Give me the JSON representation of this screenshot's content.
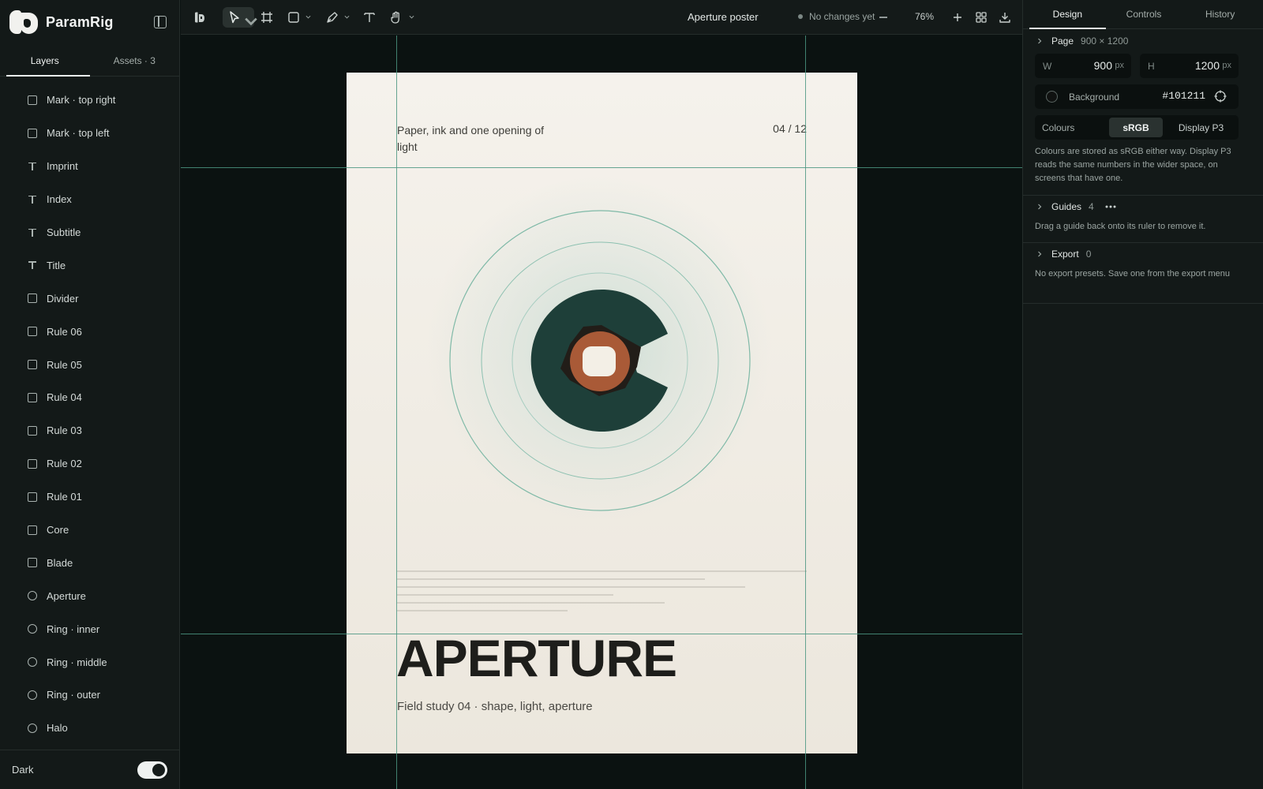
{
  "app": {
    "name": "ParamRig"
  },
  "sidebar": {
    "tabs": [
      {
        "label": "Layers"
      },
      {
        "label": "Assets · 3"
      }
    ],
    "layers": [
      {
        "name": "Mark · top right",
        "icon": "rectangle-icon"
      },
      {
        "name": "Mark · top left",
        "icon": "rectangle-icon"
      },
      {
        "name": "Imprint",
        "icon": "text-icon"
      },
      {
        "name": "Index",
        "icon": "text-icon"
      },
      {
        "name": "Subtitle",
        "icon": "text-icon"
      },
      {
        "name": "Title",
        "icon": "text-icon"
      },
      {
        "name": "Divider",
        "icon": "rectangle-icon"
      },
      {
        "name": "Rule 06",
        "icon": "rectangle-icon"
      },
      {
        "name": "Rule 05",
        "icon": "rectangle-icon"
      },
      {
        "name": "Rule 04",
        "icon": "rectangle-icon"
      },
      {
        "name": "Rule 03",
        "icon": "rectangle-icon"
      },
      {
        "name": "Rule 02",
        "icon": "rectangle-icon"
      },
      {
        "name": "Rule 01",
        "icon": "rectangle-icon"
      },
      {
        "name": "Core",
        "icon": "rectangle-icon"
      },
      {
        "name": "Blade",
        "icon": "rectangle-icon"
      },
      {
        "name": "Aperture",
        "icon": "ellipse-icon"
      },
      {
        "name": "Ring · inner",
        "icon": "ellipse-icon"
      },
      {
        "name": "Ring · middle",
        "icon": "ellipse-icon"
      },
      {
        "name": "Ring · outer",
        "icon": "ellipse-icon"
      },
      {
        "name": "Halo",
        "icon": "ellipse-icon"
      }
    ],
    "footer": {
      "label": "Dark",
      "toggle_on": true
    }
  },
  "toolbar": {
    "document_title": "Aperture poster",
    "status": "No changes yet",
    "zoom": "76%"
  },
  "panel": {
    "tabs": [
      {
        "label": "Design"
      },
      {
        "label": "Controls"
      },
      {
        "label": "History"
      }
    ],
    "page": {
      "title": "Page",
      "size": "900 × 1200",
      "width_label": "W",
      "width_value": "900",
      "width_unit": "px",
      "height_label": "H",
      "height_value": "1200",
      "height_unit": "px",
      "background_label": "Background",
      "background_value": "#101211",
      "colours_label": "Colours",
      "colour_options": [
        {
          "label": "sRGB",
          "selected": true
        },
        {
          "label": "Display P3",
          "selected": false
        }
      ],
      "colours_note": "Colours are stored as sRGB either way. Display P3 reads the same numbers in the wider space, on screens that have one."
    },
    "guides": {
      "title": "Guides",
      "count": "4",
      "note": "Drag a guide back onto its ruler to remove it."
    },
    "export": {
      "title": "Export",
      "count": "0",
      "note": "No export presets. Save one from the export menu"
    }
  },
  "poster": {
    "kicker": "Paper, ink and one opening of light",
    "index": "04 / 12",
    "title": "APERTURE",
    "subtitle": "Field study 04 · shape, light, aperture"
  },
  "colors": {
    "guide": "#4b9681",
    "aperture_dark": "#1e3f39",
    "blade_orange": "#a95a37",
    "core_cream": "#f3efe6",
    "canvas_bg": "#0b1211"
  }
}
